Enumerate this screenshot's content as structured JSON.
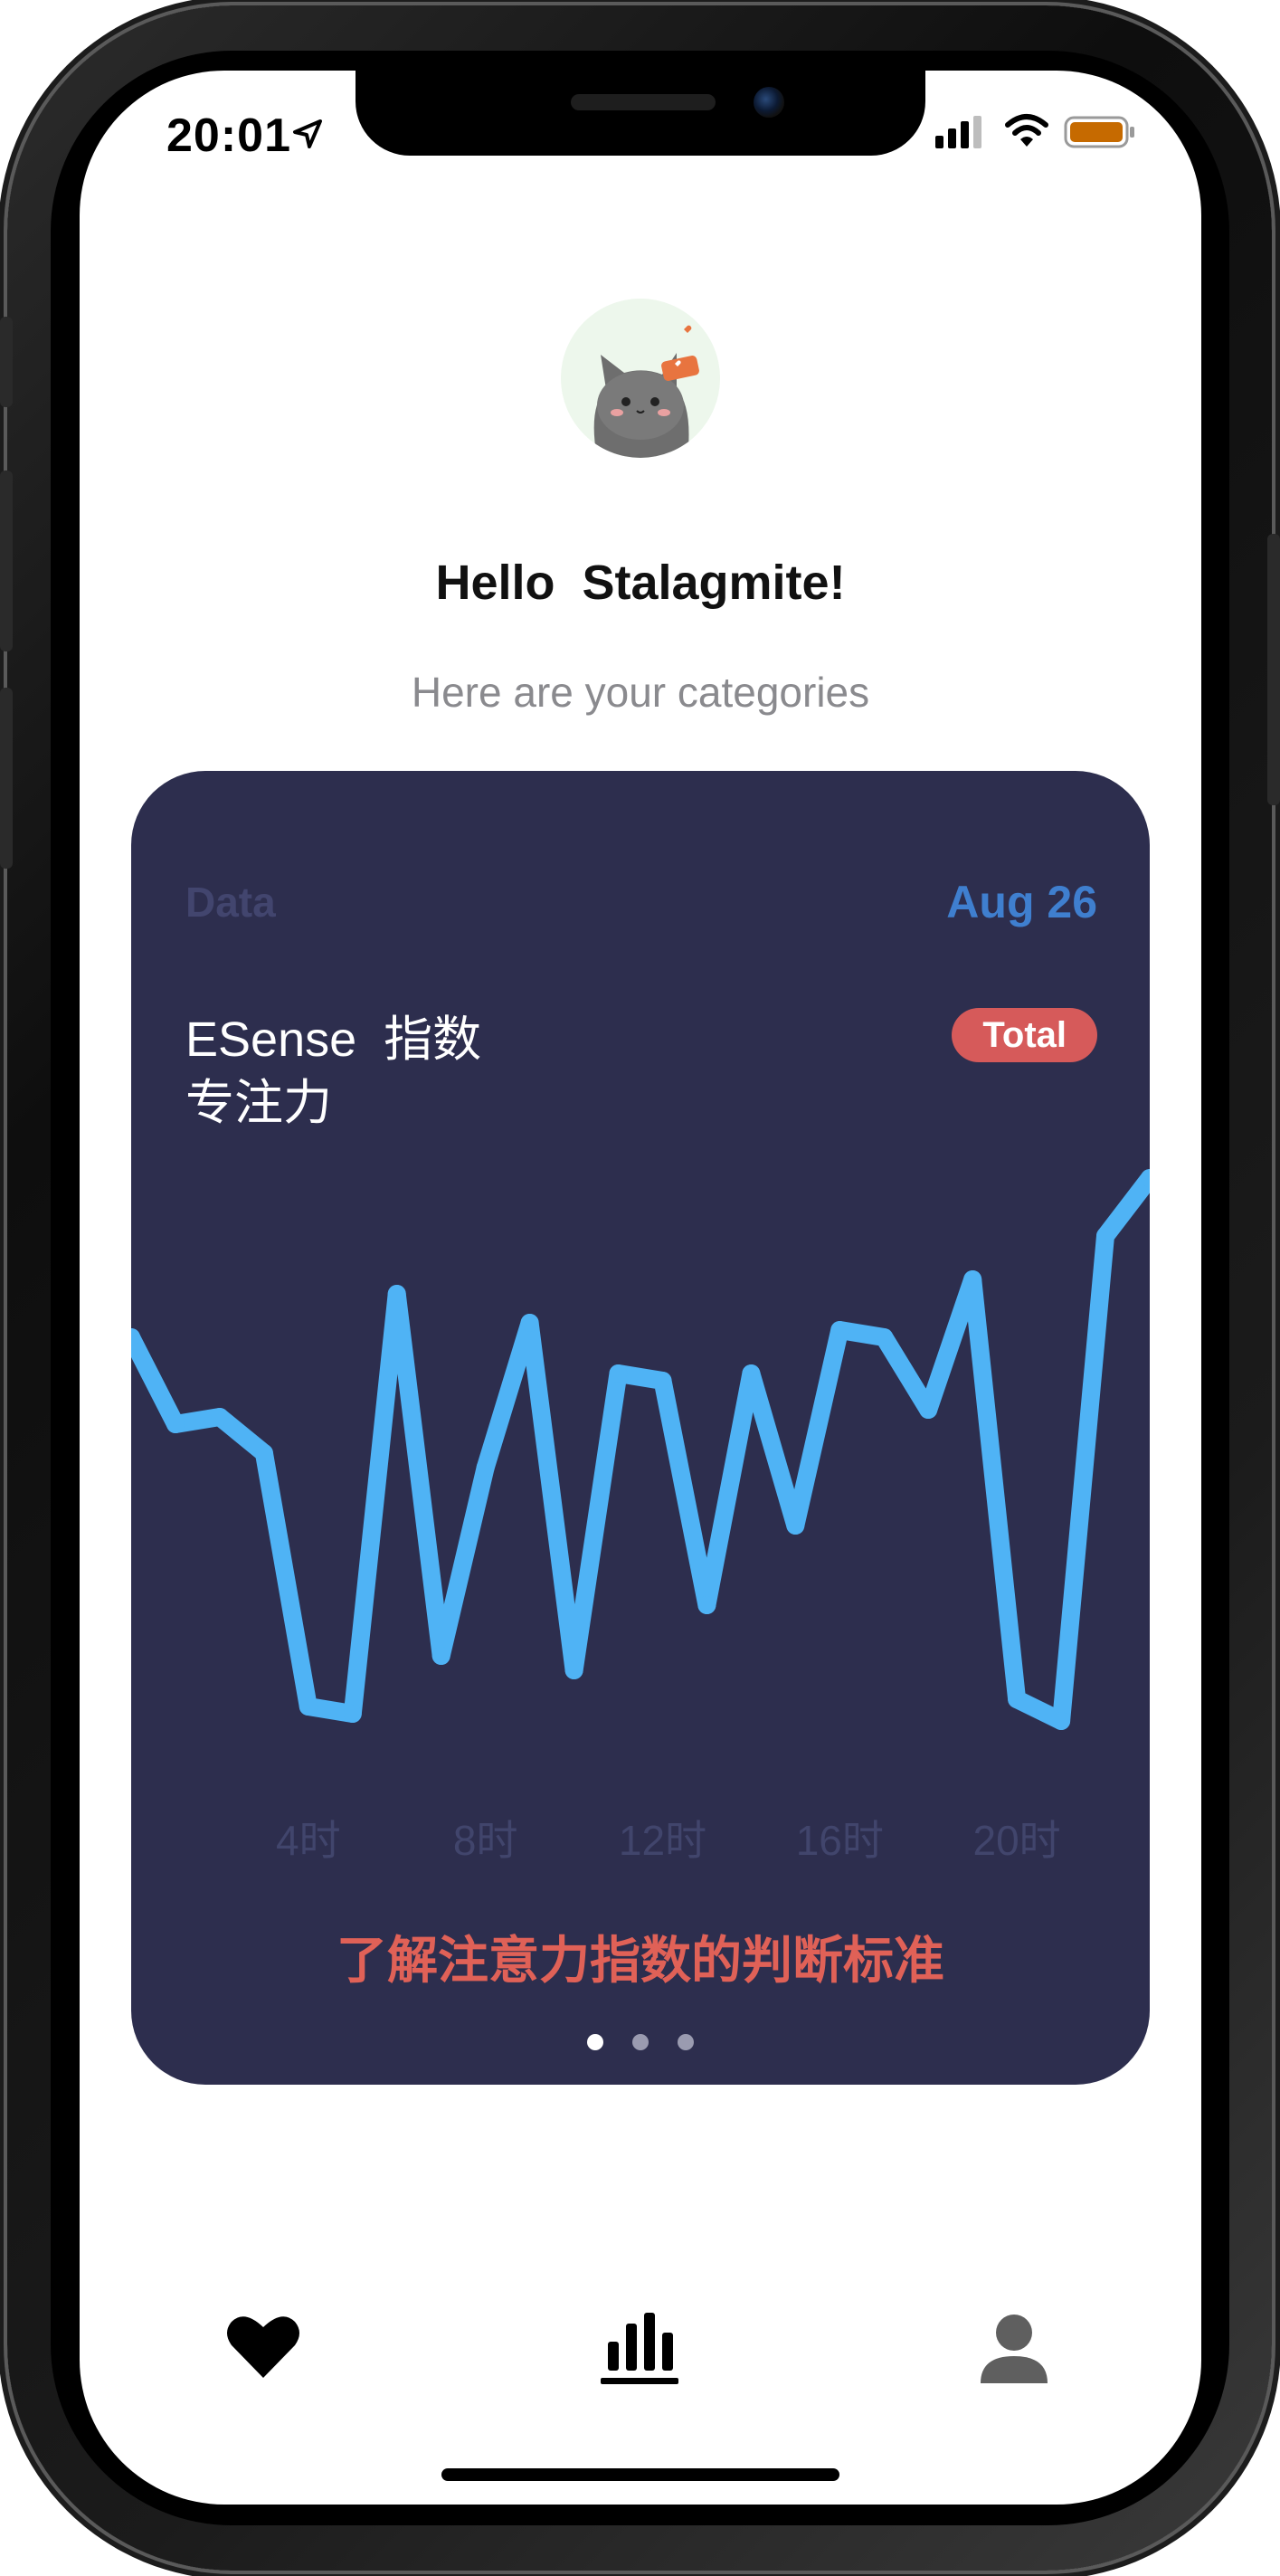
{
  "status_bar": {
    "time": "20:01",
    "icons": [
      "location-arrow-icon",
      "cellular-signal-icon",
      "wifi-icon",
      "battery-icon"
    ],
    "battery_color": "#c66a00"
  },
  "header": {
    "avatar": "cat-avatar",
    "greeting": "Hello  Stalagmite!",
    "subtitle": "Here are your categories"
  },
  "card": {
    "label": "Data",
    "date": "Aug 26",
    "title": "ESense  指数\n专注力",
    "badge": "Total",
    "link_text": "了解注意力指数的判断标准",
    "background": "#2d2e4e",
    "line_color": "#4fb3f5",
    "page_count": 3,
    "active_page": 0
  },
  "chart_data": {
    "type": "line",
    "x": [
      0,
      1,
      2,
      3,
      4,
      5,
      6,
      7,
      8,
      9,
      10,
      11,
      12,
      13,
      14,
      15,
      16,
      17,
      18,
      19,
      20,
      21,
      22,
      23
    ],
    "x_ticks": [
      "4时",
      "8时",
      "12时",
      "16时",
      "20时"
    ],
    "x_tick_positions": [
      4,
      8,
      12,
      16,
      20
    ],
    "values": [
      58,
      46,
      47,
      42,
      7,
      6,
      64,
      14,
      40,
      60,
      12,
      53,
      52,
      21,
      53,
      32,
      59,
      58,
      48,
      66,
      8,
      5,
      72,
      80
    ],
    "ylim": [
      0,
      80
    ],
    "grid": false,
    "legend": "none"
  },
  "tab_bar": {
    "tabs": [
      {
        "name": "favorites",
        "icon": "heart-icon"
      },
      {
        "name": "statistics",
        "icon": "bar-chart-icon",
        "active": true
      },
      {
        "name": "profile",
        "icon": "person-icon"
      }
    ]
  }
}
